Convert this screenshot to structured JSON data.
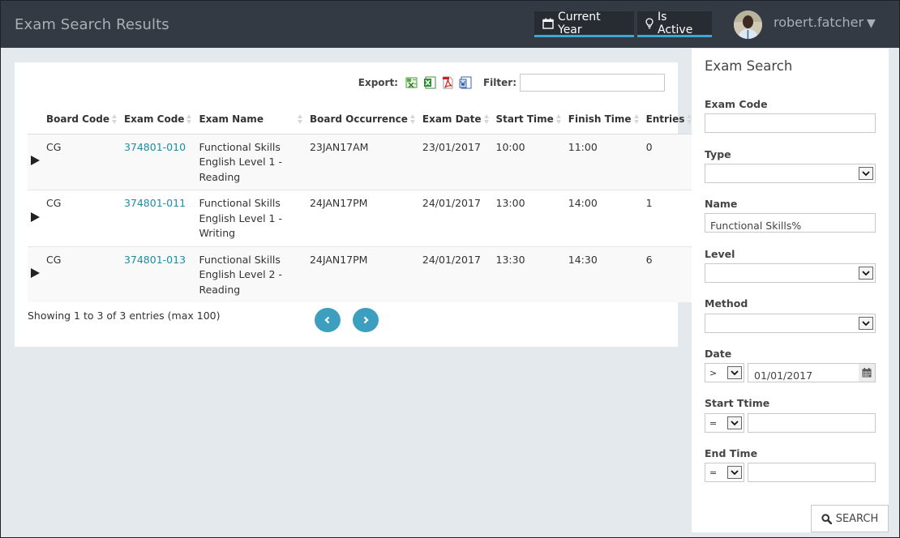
{
  "header": {
    "title": "Exam Search Results",
    "filters": [
      {
        "label": "Current Year",
        "icon": "calendar-icon"
      },
      {
        "label": "Is Active",
        "icon": "lightbulb-icon"
      }
    ],
    "user": {
      "name": "robert.fatcher",
      "caret": "▼"
    }
  },
  "results": {
    "export_label": "Export:",
    "export_formats": [
      "csv",
      "excel",
      "pdf",
      "word"
    ],
    "filter_label": "Filter:",
    "filter_value": "",
    "columns": [
      "Board Code",
      "Exam Code",
      "Exam Name",
      "Board Occurrence",
      "Exam Date",
      "Start Time",
      "Finish Time",
      "Entries"
    ],
    "rows": [
      {
        "board_code": "CG",
        "exam_code": "374801-010",
        "exam_name": "Functional Skills English Level 1 - Reading",
        "board_occurrence": "23JAN17AM",
        "exam_date": "23/01/2017",
        "start_time": "10:00",
        "finish_time": "11:00",
        "entries": "0"
      },
      {
        "board_code": "CG",
        "exam_code": "374801-011",
        "exam_name": "Functional Skills English Level 1 - Writing",
        "board_occurrence": "24JAN17PM",
        "exam_date": "24/01/2017",
        "start_time": "13:00",
        "finish_time": "14:00",
        "entries": "1"
      },
      {
        "board_code": "CG",
        "exam_code": "374801-013",
        "exam_name": "Functional Skills English Level 2 - Reading",
        "board_occurrence": "24JAN17PM",
        "exam_date": "24/01/2017",
        "start_time": "13:30",
        "finish_time": "14:30",
        "entries": "6"
      }
    ],
    "showing": "Showing 1 to 3 of 3 entries (max 100)"
  },
  "search": {
    "title": "Exam Search",
    "exam_code_label": "Exam Code",
    "exam_code_value": "",
    "type_label": "Type",
    "type_value": "",
    "name_label": "Name",
    "name_value": "Functional Skills%",
    "level_label": "Level",
    "level_value": "",
    "method_label": "Method",
    "method_value": "",
    "date_label": "Date",
    "date_operator": ">",
    "date_value": "01/01/2017",
    "start_time_label": "Start Ttime",
    "start_time_operator": "=",
    "start_time_value": "",
    "end_time_label": "End Time",
    "end_time_operator": "=",
    "end_time_value": "",
    "search_button": "SEARCH"
  },
  "colors": {
    "topbar": "#333a43",
    "accent": "#39a9d4",
    "link": "#1f8ba5",
    "pager": "#3d9fc0"
  }
}
